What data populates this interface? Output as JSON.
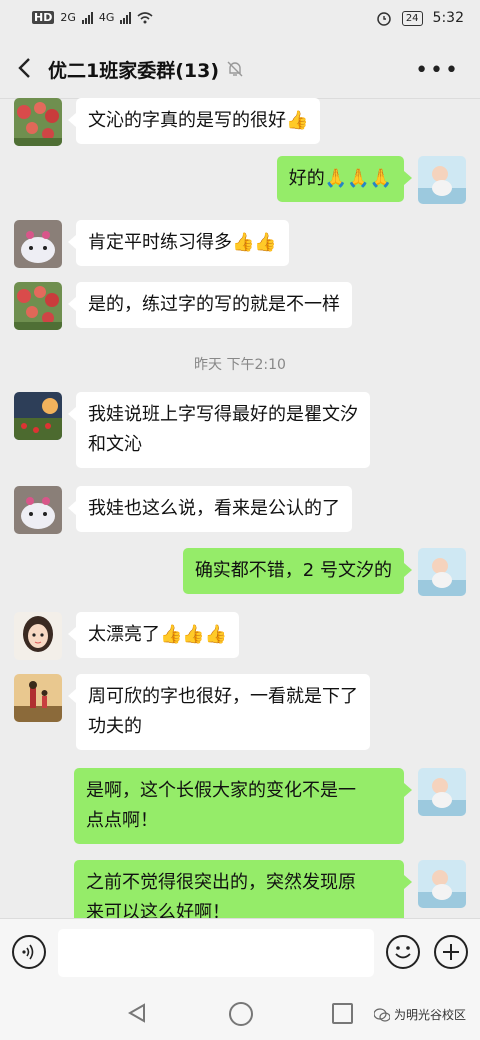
{
  "status_bar": {
    "time": "5:32",
    "battery": "24",
    "hd": "HD",
    "net1": "2G",
    "net2": "4G"
  },
  "header": {
    "title": "优二1班家委群(13)",
    "more": "•••"
  },
  "timestamp": "昨天 下午2:10",
  "messages": [
    {
      "side": "left",
      "avatar": "flowers-avatar",
      "text": "文沁的字真的是写的很好",
      "emoji": "👍"
    },
    {
      "side": "right",
      "avatar": "baby-avatar",
      "text": "好的",
      "emoji": "🙏🙏🙏"
    },
    {
      "side": "left",
      "avatar": "plush-toy-avatar",
      "text": "肯定平时练习得多",
      "emoji": "👍👍"
    },
    {
      "side": "left",
      "avatar": "flowers-avatar",
      "text": "是的，练过字的写的就是不一样",
      "emoji": ""
    },
    {
      "side": "left",
      "avatar": "sunset-field-avatar",
      "text": "我娃说班上字写得最好的是瞿文汐\n和文沁",
      "emoji": ""
    },
    {
      "side": "left",
      "avatar": "plush-toy-avatar",
      "text": "我娃也这么说，看来是公认的了",
      "emoji": ""
    },
    {
      "side": "right",
      "avatar": "baby-avatar",
      "text": "确实都不错，2 号文汐的",
      "emoji": ""
    },
    {
      "side": "left",
      "avatar": "cartoon-girl-avatar",
      "text": "太漂亮了",
      "emoji": "👍👍👍"
    },
    {
      "side": "left",
      "avatar": "mother-child-avatar",
      "text": "周可欣的字也很好，一看就是下了\n功夫的",
      "emoji": ""
    },
    {
      "side": "right",
      "avatar": "baby-avatar",
      "text": "是啊，这个长假大家的变化不是一\n点点啊！",
      "emoji": ""
    },
    {
      "side": "right",
      "avatar": "baby-avatar",
      "text": "之前不觉得很突出的，突然发现原\n来可以这么好啊！",
      "emoji": ""
    }
  ],
  "watermark": "为明光谷校区",
  "colors": {
    "background": "#ededed",
    "bubble_green": "#95ec69",
    "bubble_white": "#ffffff"
  }
}
